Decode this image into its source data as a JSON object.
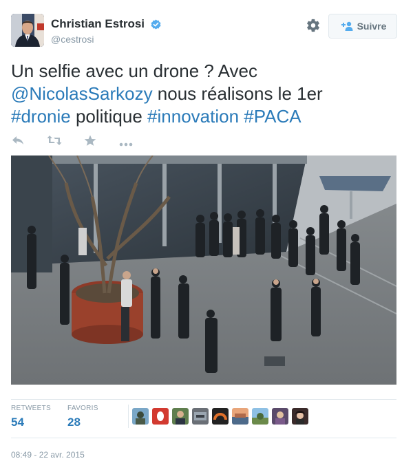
{
  "author": {
    "name": "Christian Estrosi",
    "handle": "@cestrosi",
    "verified": true
  },
  "follow_button": {
    "label": "Suivre",
    "icon": "add-user-icon"
  },
  "tweet": {
    "line1": "Un selfie avec un drone ? Avec",
    "mention": "@NicolasSarkozy",
    "line2_rest": " nous réalisons le 1er",
    "hashtag1": "#dronie",
    "word_politique": " politique ",
    "hashtag2": "#innovation",
    "hashtag3": "#PACA"
  },
  "actions": [
    "reply-icon",
    "retweet-icon",
    "favorite-icon",
    "more-icon"
  ],
  "stats": {
    "retweets_label": "RETWEETS",
    "retweets_value": "54",
    "favorites_label": "FAVORIS",
    "favorites_value": "28"
  },
  "timestamp": "08:49 - 22 avr. 2015",
  "colors": {
    "link": "#2b7bb9",
    "text": "#292f33",
    "muted": "#8899a6",
    "verified": "#55acee",
    "divider": "#e1e8ed"
  }
}
